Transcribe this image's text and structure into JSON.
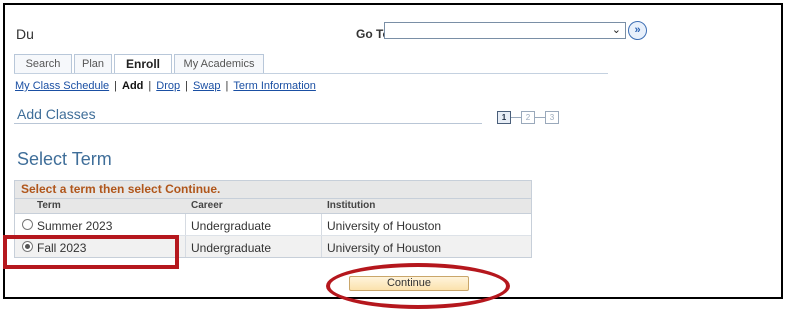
{
  "header": {
    "user": "Du",
    "goto_label": "Go To",
    "goto_value": "",
    "goto_caret": "⌄",
    "goto_button": "»"
  },
  "tabs": [
    {
      "label": "Search",
      "active": false
    },
    {
      "label": "Plan",
      "active": false
    },
    {
      "label": "Enroll",
      "active": true
    },
    {
      "label": "My Academics",
      "active": false
    }
  ],
  "subnav": {
    "items": [
      "My Class Schedule",
      "Add",
      "Drop",
      "Swap",
      "Term Information"
    ],
    "current": "Add",
    "separator": "|"
  },
  "section_title": "Add Classes",
  "steps": [
    "1",
    "2",
    "3"
  ],
  "active_step": "1",
  "page_heading": "Select Term",
  "term_grid": {
    "caption": "Select a term then select Continue.",
    "columns": [
      "Term",
      "Career",
      "Institution"
    ],
    "rows": [
      {
        "term": "Summer 2023",
        "career": "Undergraduate",
        "institution": "University of Houston",
        "selected": false
      },
      {
        "term": "Fall 2023",
        "career": "Undergraduate",
        "institution": "University of Houston",
        "selected": true
      }
    ]
  },
  "continue_label": "Continue",
  "colors": {
    "heading_blue": "#3f6e99",
    "caption_orange": "#b0561b",
    "highlight_red": "#b5171d",
    "button_fill": "#fbe2ad"
  }
}
